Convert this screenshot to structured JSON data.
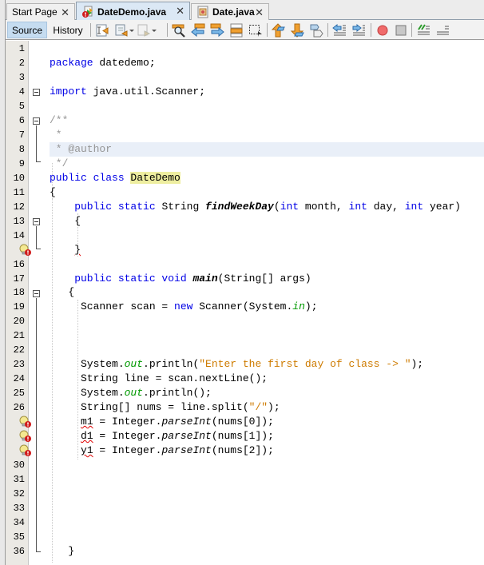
{
  "tabs": [
    {
      "label": "Start Page",
      "active": false,
      "icon": "none"
    },
    {
      "label": "DateDemo.java",
      "active": true,
      "icon": "java-file-error-icon"
    },
    {
      "label": "Date.java",
      "active": false,
      "icon": "java-file-icon"
    }
  ],
  "close_glyph": "✕",
  "toolbar": {
    "source_label": "Source",
    "history_label": "History",
    "icons": [
      "last-edit-icon",
      "back-icon",
      "forward-icon",
      "find-icon",
      "find-previous-icon",
      "find-next-icon",
      "toggle-highlight-icon",
      "rectangular-selection-icon",
      "previous-bookmark-icon",
      "next-bookmark-icon",
      "toggle-bookmark-icon",
      "shift-left-icon",
      "shift-right-icon",
      "start-macro-icon",
      "stop-macro-icon",
      "comment-icon",
      "uncomment-icon"
    ]
  },
  "editor": {
    "line_numbers": [
      "1",
      "2",
      "3",
      "4",
      "5",
      "6",
      "7",
      "8",
      "9",
      "10",
      "11",
      "12",
      "13",
      "14",
      "",
      "16",
      "17",
      "18",
      "19",
      "20",
      "21",
      "22",
      "23",
      "24",
      "25",
      "26",
      "",
      "",
      "",
      "30",
      "31",
      "32",
      "33",
      "34",
      "35",
      "36"
    ],
    "error_lines": [
      15,
      27,
      28,
      29
    ],
    "current_line": 8,
    "lines": [
      [],
      [
        {
          "t": "package ",
          "c": "kw"
        },
        {
          "t": "datedemo;",
          "c": ""
        }
      ],
      [],
      [
        {
          "t": "import ",
          "c": "kw"
        },
        {
          "t": "java.util.Scanner;",
          "c": ""
        }
      ],
      [],
      [
        {
          "t": "/**",
          "c": "cm"
        }
      ],
      [
        {
          "t": " *",
          "c": "cm"
        }
      ],
      [
        {
          "t": " * @author",
          "c": "cm"
        }
      ],
      [
        {
          "t": " */",
          "c": "cm"
        }
      ],
      [
        {
          "t": "public class ",
          "c": "kw"
        },
        {
          "t": "DateDemo",
          "c": "hl"
        }
      ],
      [
        {
          "t": "{",
          "c": ""
        }
      ],
      [
        {
          "t": "    public static ",
          "c": "kw"
        },
        {
          "t": "String ",
          "c": ""
        },
        {
          "t": "findWeekDay",
          "c": "bi"
        },
        {
          "t": "(",
          "c": ""
        },
        {
          "t": "int ",
          "c": "kw"
        },
        {
          "t": "month, ",
          "c": ""
        },
        {
          "t": "int ",
          "c": "kw"
        },
        {
          "t": "day, ",
          "c": ""
        },
        {
          "t": "int ",
          "c": "kw"
        },
        {
          "t": "year)",
          "c": ""
        }
      ],
      [
        {
          "t": "    {",
          "c": ""
        }
      ],
      [],
      [
        {
          "t": "    ",
          "c": ""
        },
        {
          "t": "}",
          "c": "err"
        }
      ],
      [],
      [
        {
          "t": "    public static void ",
          "c": "kw"
        },
        {
          "t": "main",
          "c": "bi"
        },
        {
          "t": "(String[] args)",
          "c": ""
        }
      ],
      [
        {
          "t": "   {",
          "c": ""
        }
      ],
      [
        {
          "t": "     Scanner scan = ",
          "c": ""
        },
        {
          "t": "new ",
          "c": "kw"
        },
        {
          "t": "Scanner(System.",
          "c": ""
        },
        {
          "t": "in",
          "c": "fld"
        },
        {
          "t": ");",
          "c": ""
        }
      ],
      [],
      [],
      [],
      [
        {
          "t": "     System.",
          "c": ""
        },
        {
          "t": "out",
          "c": "fld"
        },
        {
          "t": ".println(",
          "c": ""
        },
        {
          "t": "\"Enter the first day of class -> \"",
          "c": "str"
        },
        {
          "t": ");",
          "c": ""
        }
      ],
      [
        {
          "t": "     String line = scan.nextLine();",
          "c": ""
        }
      ],
      [
        {
          "t": "     System.",
          "c": ""
        },
        {
          "t": "out",
          "c": "fld"
        },
        {
          "t": ".println();",
          "c": ""
        }
      ],
      [
        {
          "t": "     String[] nums = line.split(",
          "c": ""
        },
        {
          "t": "\"/\"",
          "c": "str"
        },
        {
          "t": ");",
          "c": ""
        }
      ],
      [
        {
          "t": "     ",
          "c": ""
        },
        {
          "t": "m1",
          "c": "err"
        },
        {
          "t": " = Integer.",
          "c": ""
        },
        {
          "t": "parseInt",
          "c": "it"
        },
        {
          "t": "(nums[0]);",
          "c": ""
        }
      ],
      [
        {
          "t": "     ",
          "c": ""
        },
        {
          "t": "d1",
          "c": "err"
        },
        {
          "t": " = Integer.",
          "c": ""
        },
        {
          "t": "parseInt",
          "c": "it"
        },
        {
          "t": "(nums[1]);",
          "c": ""
        }
      ],
      [
        {
          "t": "     ",
          "c": ""
        },
        {
          "t": "y1",
          "c": "err"
        },
        {
          "t": " = Integer.",
          "c": ""
        },
        {
          "t": "parseInt",
          "c": "it"
        },
        {
          "t": "(nums[2]);",
          "c": ""
        }
      ],
      [],
      [],
      [],
      [],
      [],
      [],
      [
        {
          "t": "   }",
          "c": ""
        }
      ]
    ]
  }
}
